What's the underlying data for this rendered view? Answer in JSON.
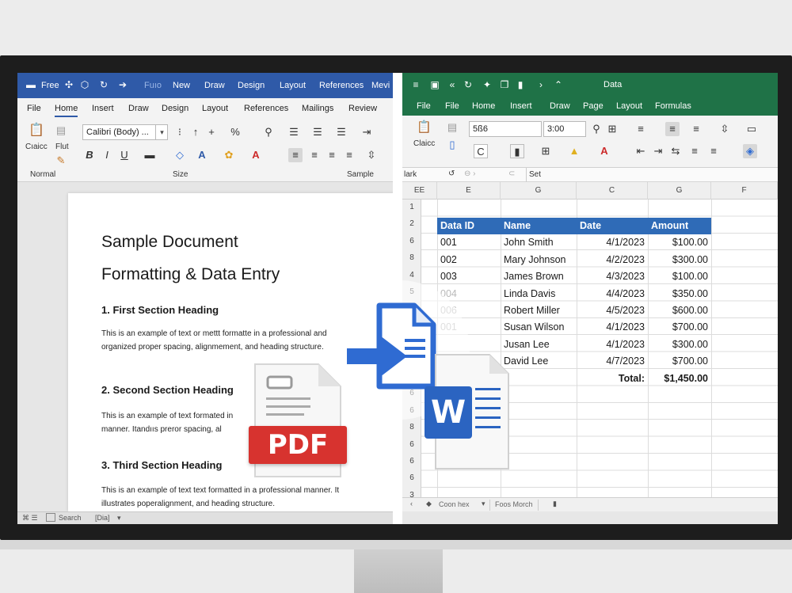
{
  "word": {
    "title_items": [
      "Free",
      "Fuıo",
      "New",
      "Draw",
      "Design",
      "Layout",
      "References",
      "Mevi"
    ],
    "menu": [
      "File",
      "Home",
      "Insert",
      "Draw",
      "Design",
      "Layout",
      "References",
      "Mailings",
      "Review"
    ],
    "ribbon": {
      "clipboard_label": "Cıaicc",
      "flut_label": "Flut",
      "font_name": "Calibri (Body) ...",
      "groups": [
        "Normal",
        "Size",
        "Sample"
      ]
    },
    "doc": {
      "title_line1": "Sample Document",
      "title_line2": "Formatting & Data Entry",
      "h1": "1. First Section Heading",
      "p1": "This is an example of text or mettt formatte in a professional and organized proper spacing, alignmement, and heading structure.",
      "h2": "2. Second Section Heading",
      "p2": "This is an example of text formated in manner. Itandııs preror spacing, al",
      "h3": "3. Third Section Heading",
      "p3": "This is an example of text text formatted in a professional manner. It illustrates poperalignment, and heading structure."
    },
    "status": {
      "search": "Search",
      "zoom": "[Dia]"
    }
  },
  "excel": {
    "title": "Data",
    "menu": [
      "File",
      "File",
      "Home",
      "Insert",
      "Draw",
      "Page",
      "Layout",
      "Formulas"
    ],
    "ribbon": {
      "font_size_box": "5ß6",
      "size_box": "3:00",
      "clipboard_label": "Claicc"
    },
    "formula_bar": {
      "name_box": "lark",
      "content": "Set"
    },
    "col_headers": [
      "EE",
      "E",
      "G",
      "C",
      "G",
      "F"
    ],
    "row_headers": [
      "1",
      "2",
      "6",
      "8",
      "4",
      "5",
      "6",
      "7",
      "6",
      "6",
      "8",
      "6",
      "6",
      "8",
      "6",
      "6",
      "6",
      "3"
    ],
    "table": {
      "headers": [
        "Data ID",
        "Name",
        "Date",
        "Amount"
      ],
      "rows": [
        [
          "001",
          "John Smith",
          "4/1/2023",
          "$100.00"
        ],
        [
          "002",
          "Mary Johnson",
          "4/2/2023",
          "$300.00"
        ],
        [
          "003",
          "James Brown",
          "4/3/2023",
          "$100.00"
        ],
        [
          "004",
          "Linda Davis",
          "4/4/2023",
          "$350.00"
        ],
        [
          "006",
          "Robert Miller",
          "4/5/2023",
          "$600.00"
        ],
        [
          "001",
          "Susan Wilson",
          "4/1/2023",
          "$700.00"
        ],
        [
          "",
          "Jusan Lee",
          "4/1/2023",
          "$300.00"
        ],
        [
          "",
          "David Lee",
          "4/7/2023",
          "$700.00"
        ]
      ],
      "total_label": "Total:",
      "total_value": "$1,450.00"
    },
    "sheets": [
      "Coon hex",
      "Foos Morch"
    ]
  },
  "overlay": {
    "pdf_label": "PDF",
    "word_letter": "W",
    "colors": {
      "pdf_red": "#d7332f",
      "arrow_blue": "#2f6bd2",
      "word_blue": "#2b64c1"
    }
  },
  "colors": {
    "word_blue": "#2f5aa8",
    "excel_green": "#1f7247",
    "table_header": "#2f6bb7"
  }
}
